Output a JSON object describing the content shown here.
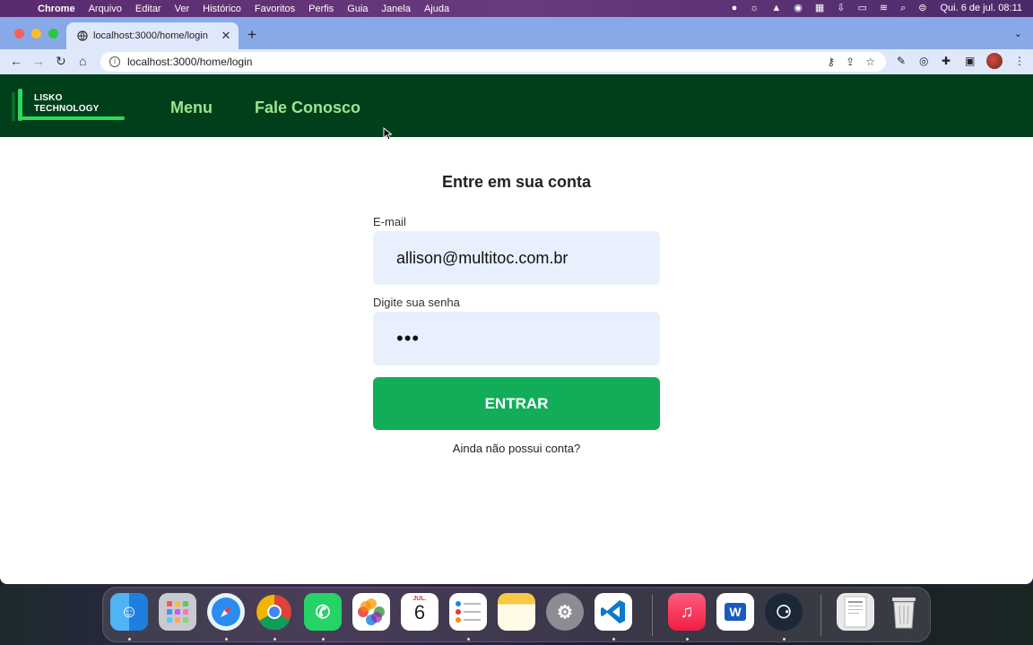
{
  "menubar": {
    "app": "Chrome",
    "items": [
      "Arquivo",
      "Editar",
      "Ver",
      "Histórico",
      "Favoritos",
      "Perfis",
      "Guia",
      "Janela",
      "Ajuda"
    ],
    "clock": "Qui. 6 de jul.  08:11"
  },
  "browser": {
    "tab_title": "localhost:3000/home/login",
    "url": "localhost:3000/home/login"
  },
  "site": {
    "logo_line1": "LISKO",
    "logo_line2": "TECHNOLOGY",
    "nav_menu": "Menu",
    "nav_contact": "Fale Conosco"
  },
  "login": {
    "title": "Entre em sua conta",
    "email_label": "E-mail",
    "email_value": "allison@multitoc.com.br",
    "password_label": "Digite sua senha",
    "password_value": "•••",
    "submit_label": "ENTRAR",
    "signup_link": "Ainda não possui conta?"
  },
  "dock": {
    "calendar_month": "JUL.",
    "calendar_day": "6"
  },
  "colors": {
    "header_bg": "#013f1a",
    "nav_link": "#9be68f",
    "button": "#12ad59",
    "input_bg": "#e8f0fe"
  }
}
